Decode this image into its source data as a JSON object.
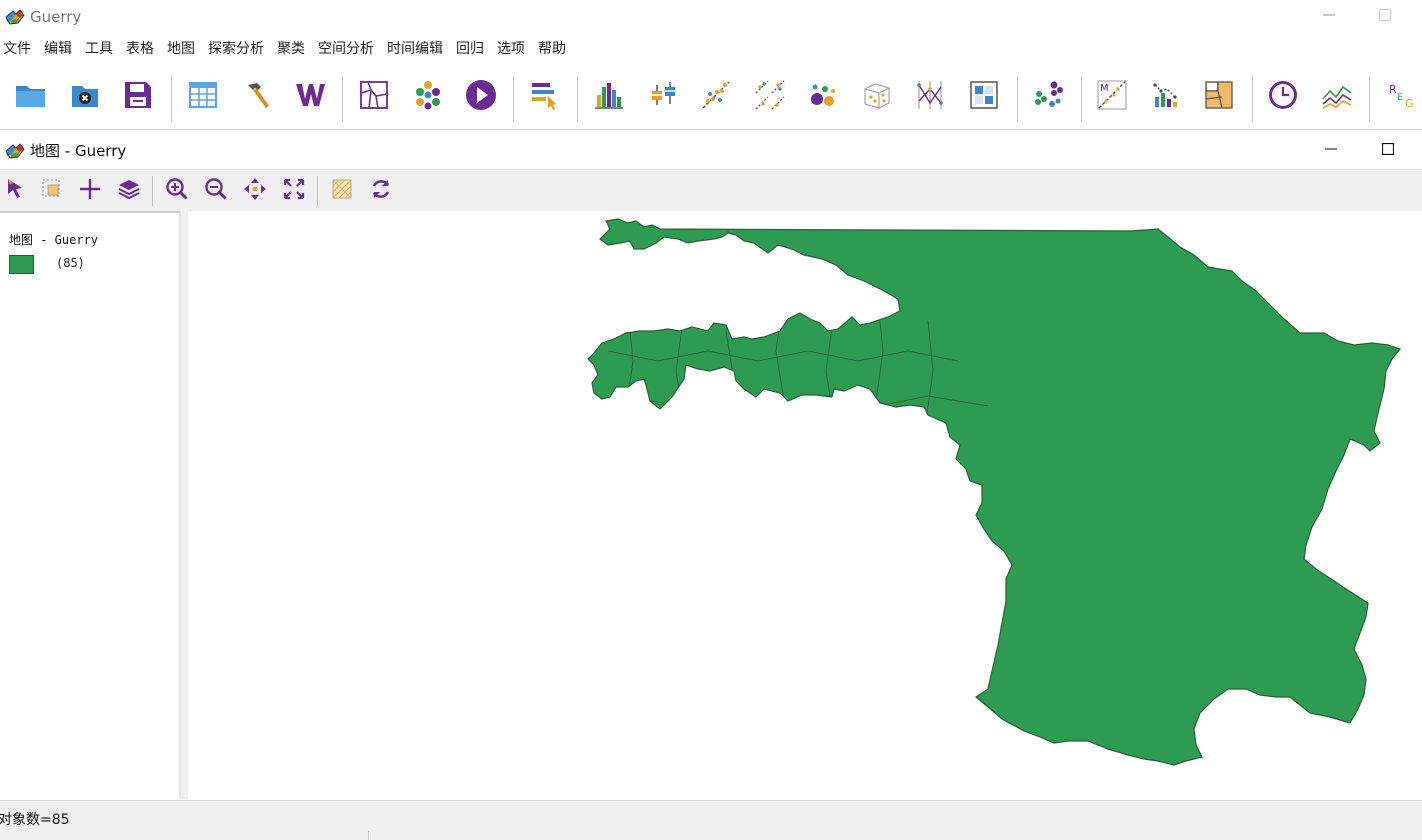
{
  "app": {
    "title": "Guerry",
    "accent_color": "#6a2c91",
    "logo_icon": "geoda-logo-icon",
    "minimize_icon": "minimize-icon",
    "maximize_icon": "maximize-icon"
  },
  "menu": {
    "items": [
      {
        "label": "文件"
      },
      {
        "label": "编辑"
      },
      {
        "label": "工具"
      },
      {
        "label": "表格"
      },
      {
        "label": "地图"
      },
      {
        "label": "探索分析"
      },
      {
        "label": "聚类"
      },
      {
        "label": "空间分析"
      },
      {
        "label": "时间编辑"
      },
      {
        "label": "回归"
      },
      {
        "label": "选项"
      },
      {
        "label": "帮助"
      }
    ]
  },
  "toolbar": {
    "buttons": [
      {
        "icon": "open-folder-icon"
      },
      {
        "icon": "close-project-icon"
      },
      {
        "icon": "save-icon"
      },
      {
        "icon": "table-icon"
      },
      {
        "icon": "tools-hammer-icon"
      },
      {
        "icon": "weights-w-icon"
      },
      {
        "icon": "map-icon"
      },
      {
        "icon": "cluster-map-icon"
      },
      {
        "icon": "play-icon"
      },
      {
        "icon": "select-tool-icon"
      },
      {
        "icon": "histogram-icon"
      },
      {
        "icon": "box-plot-icon"
      },
      {
        "icon": "scatter-plot-icon"
      },
      {
        "icon": "scatter-matrix-icon"
      },
      {
        "icon": "bubble-chart-icon"
      },
      {
        "icon": "3d-scatter-icon"
      },
      {
        "icon": "parallel-coordinates-icon"
      },
      {
        "icon": "conditional-plot-icon"
      },
      {
        "icon": "cluster-dots-icon"
      },
      {
        "icon": "moran-scatter-icon"
      },
      {
        "icon": "correlogram-icon"
      },
      {
        "icon": "cartogram-icon"
      },
      {
        "icon": "time-clock-icon"
      },
      {
        "icon": "averages-chart-icon"
      },
      {
        "icon": "regression-icon"
      }
    ]
  },
  "map_window": {
    "title": "地图 - Guerry",
    "tools": [
      {
        "icon": "pointer-select-icon"
      },
      {
        "icon": "selection-shape-icon"
      },
      {
        "icon": "add-layer-icon"
      },
      {
        "icon": "layers-icon"
      },
      {
        "icon": "zoom-in-icon"
      },
      {
        "icon": "zoom-out-icon"
      },
      {
        "icon": "pan-icon"
      },
      {
        "icon": "full-extent-icon"
      },
      {
        "icon": "basemap-icon"
      },
      {
        "icon": "refresh-icon"
      }
    ]
  },
  "legend": {
    "title": "地图 - Guerry",
    "category_count": "(85)",
    "fill_color": "#2e9b52",
    "outline_color": "#2a5d3a"
  },
  "status": {
    "text": "对象数=85"
  }
}
